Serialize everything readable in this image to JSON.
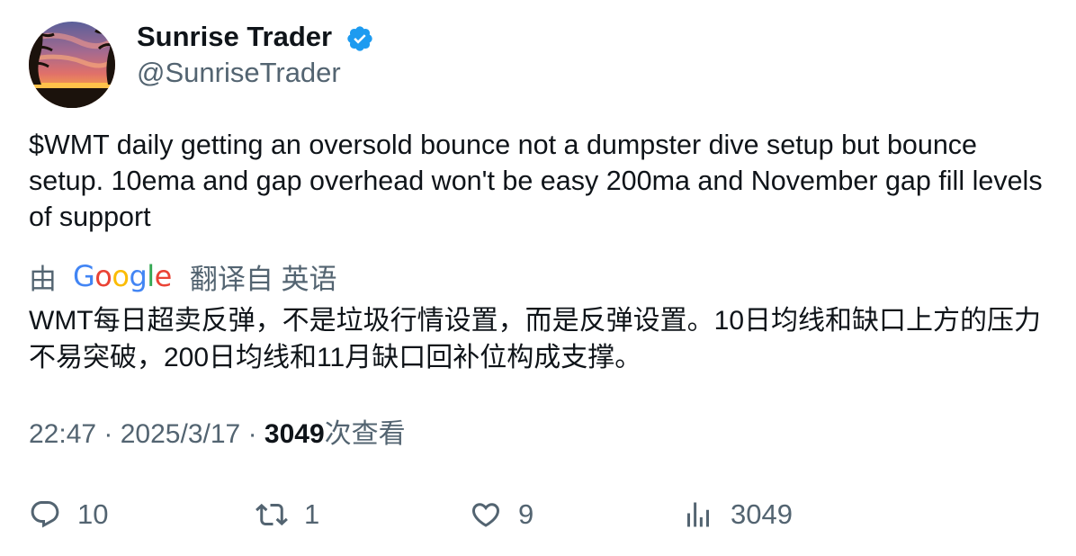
{
  "author": {
    "display_name": "Sunrise Trader",
    "handle": "@SunriseTrader",
    "verified": true,
    "avatar": "sunset-landscape-avatar"
  },
  "tweet": {
    "text": "$WMT daily getting an oversold bounce not a dumpster dive setup but bounce setup.  10ema and gap overhead won't be easy  200ma and November gap fill levels of support"
  },
  "translation": {
    "prefix": "由",
    "provider": "Google",
    "suffix": "翻译自 英语",
    "text": "WMT每日超卖反弹，不是垃圾行情设置，而是反弹设置。10日均线和缺口上方的压力不易突破，200日均线和11月缺口回补位构成支撑。"
  },
  "meta": {
    "time": "22:47",
    "separator": "·",
    "date": "2025/3/17",
    "views_count": "3049",
    "views_label": "次查看"
  },
  "actions": {
    "replies": "10",
    "retweets": "1",
    "likes": "9",
    "views": "3049"
  },
  "colors": {
    "text_primary": "#0f1419",
    "text_secondary": "#536471",
    "verified_blue": "#1d9bf0"
  },
  "icons": [
    "reply-icon",
    "retweet-icon",
    "like-icon",
    "views-icon",
    "verified-badge-icon"
  ]
}
